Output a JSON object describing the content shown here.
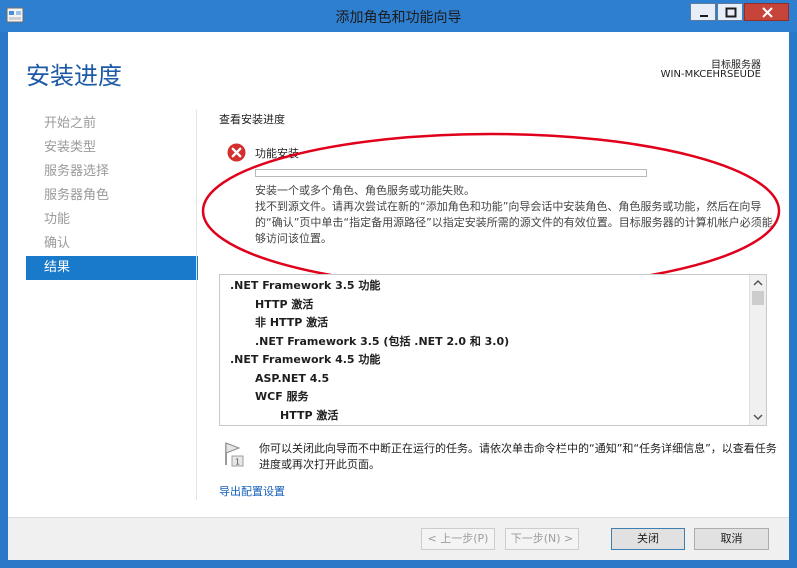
{
  "window": {
    "title": "添加角色和功能向导"
  },
  "header": {
    "page_title": "安装进度",
    "destination_label": "目标服务器",
    "destination_name": "WIN-MKCEHRSEUDE"
  },
  "nav": {
    "items": [
      {
        "label": "开始之前",
        "active": false
      },
      {
        "label": "安装类型",
        "active": false
      },
      {
        "label": "服务器选择",
        "active": false
      },
      {
        "label": "服务器角色",
        "active": false
      },
      {
        "label": "功能",
        "active": false
      },
      {
        "label": "确认",
        "active": false
      },
      {
        "label": "结果",
        "active": true
      }
    ]
  },
  "main": {
    "section_title": "查看安装进度",
    "feature_label": "功能安装",
    "progress_fraction": 0,
    "message_line1": "安装一个或多个角色、角色服务或功能失败。",
    "message_line2": "找不到源文件。请再次尝试在新的“添加角色和功能”向导会话中安装角色、角色服务或功能，然后在向导的“确认”页中单击“指定备用源路径”以指定安装所需的源文件的有效位置。目标服务器的计算机帐户必须能够访问该位置。",
    "list_items": [
      {
        "label": ".NET Framework 3.5 功能",
        "level": 0
      },
      {
        "label": "HTTP 激活",
        "level": 1
      },
      {
        "label": "非 HTTP 激活",
        "level": 1
      },
      {
        "label": ".NET Framework 3.5 (包括 .NET 2.0 和 3.0)",
        "level": 1
      },
      {
        "label": ".NET Framework 4.5 功能",
        "level": 0
      },
      {
        "label": "ASP.NET 4.5",
        "level": 1
      },
      {
        "label": "WCF 服务",
        "level": 1
      },
      {
        "label": "HTTP 激活",
        "level": 2
      }
    ],
    "note_text": "你可以关闭此向导而不中断正在运行的任务。请依次单击命令栏中的“通知”和“任务详细信息”，以查看任务进度或再次打开此页面。",
    "flag_badge": "1",
    "export_link": "导出配置设置"
  },
  "footer": {
    "prev_label": "< 上一步(P)",
    "next_label": "下一步(N) >",
    "close_label": "关闭",
    "cancel_label": "取消"
  },
  "colors": {
    "accent": "#1979ca",
    "title_bar": "#2f7fd0",
    "error_red": "#d32f2f",
    "annotation_red": "#e0001b"
  },
  "icons": {
    "app": "wizard-app-icon",
    "error": "error-x-icon",
    "flag": "flag-icon"
  }
}
